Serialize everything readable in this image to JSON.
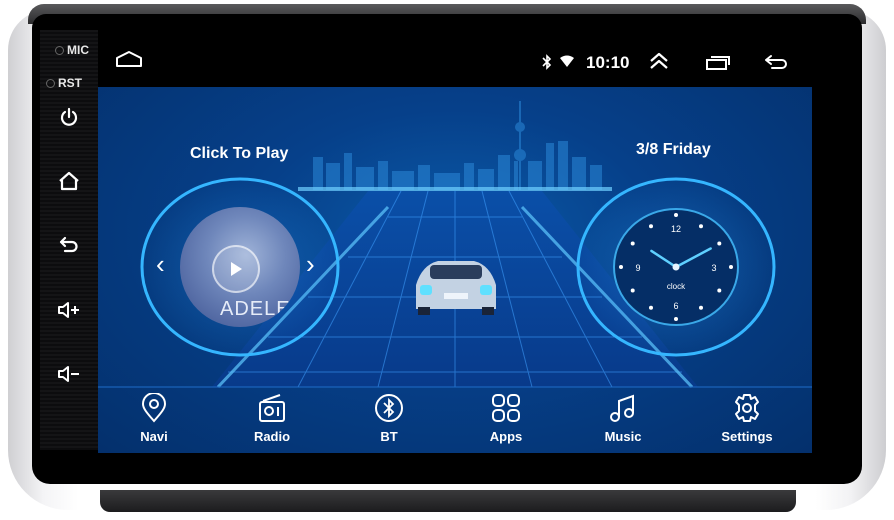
{
  "device": {
    "side_labels": {
      "mic": "MIC",
      "rst": "RST"
    },
    "side_buttons": [
      {
        "name": "power",
        "icon": "power-icon"
      },
      {
        "name": "home",
        "icon": "home-icon"
      },
      {
        "name": "back",
        "icon": "back-icon"
      },
      {
        "name": "volume-up",
        "icon": "volume-up-icon"
      },
      {
        "name": "volume-down",
        "icon": "volume-down-icon"
      }
    ]
  },
  "status_bar": {
    "time": "10:10",
    "icons": [
      "home-outline-icon",
      "bluetooth-icon",
      "wifi-icon",
      "double-chevron-up-icon",
      "recent-apps-icon",
      "back-icon"
    ]
  },
  "music_widget": {
    "label": "Click To Play",
    "album_text": "ADELE",
    "prev_glyph": "‹",
    "next_glyph": "›"
  },
  "clock_widget": {
    "date": "3/8",
    "day": "Friday",
    "clock_label": "clock",
    "numerals": {
      "n12": "12",
      "n3": "3",
      "n6": "6",
      "n9": "9"
    },
    "time": {
      "hours": 10,
      "minutes": 10
    }
  },
  "dock": {
    "items": [
      {
        "label": "Navi",
        "icon": "location-pin-icon"
      },
      {
        "label": "Radio",
        "icon": "radio-icon"
      },
      {
        "label": "BT",
        "icon": "bluetooth-icon"
      },
      {
        "label": "Apps",
        "icon": "apps-grid-icon"
      },
      {
        "label": "Music",
        "icon": "music-note-icon"
      },
      {
        "label": "Settings",
        "icon": "gear-icon"
      }
    ]
  },
  "colors": {
    "screen_bg": "#04306c",
    "accent": "#4fc3f7",
    "text": "#ffffff"
  }
}
